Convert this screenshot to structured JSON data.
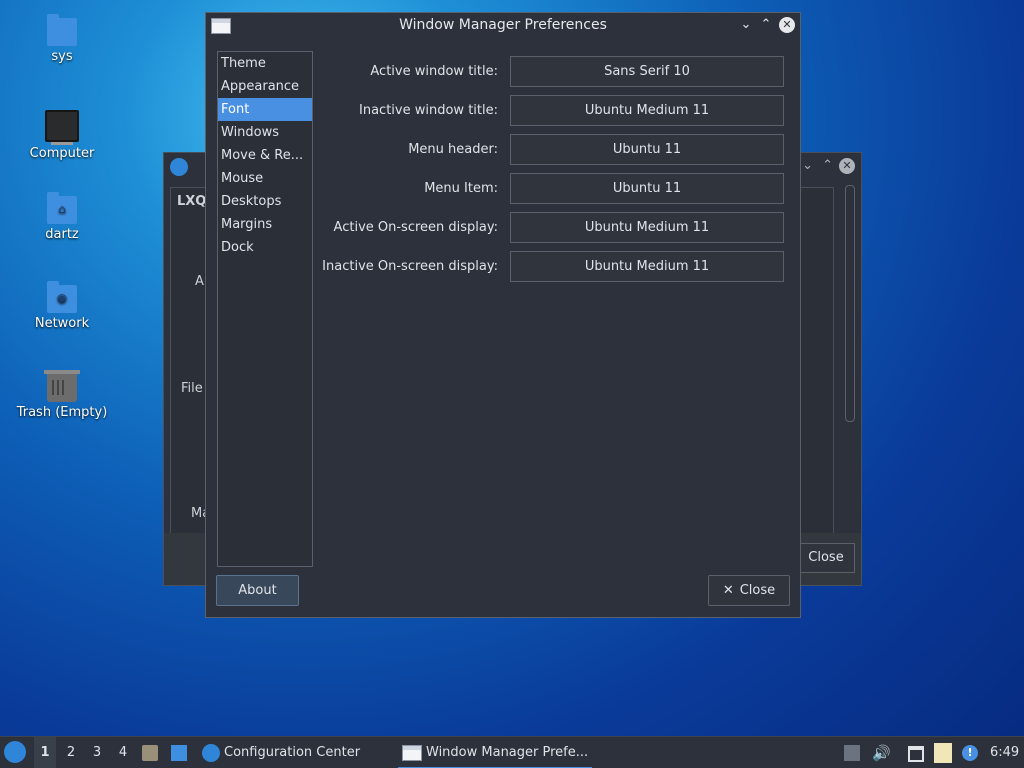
{
  "desktop": {
    "icons": [
      {
        "label": "sys",
        "icon": "folder-icon"
      },
      {
        "label": "Computer",
        "icon": "computer-icon"
      },
      {
        "label": "dartz",
        "icon": "home-folder-icon"
      },
      {
        "label": "Network",
        "icon": "network-folder-icon"
      },
      {
        "label": "Trash (Empty)",
        "icon": "trash-icon"
      }
    ]
  },
  "background_window": {
    "partial_texts": [
      "LXQ",
      "A",
      "File",
      "Ma"
    ],
    "close_label": "Close"
  },
  "window": {
    "title": "Window Manager Preferences",
    "sidebar": {
      "items": [
        "Theme",
        "Appearance",
        "Font",
        "Windows",
        "Move & Re...",
        "Mouse",
        "Desktops",
        "Margins",
        "Dock"
      ],
      "selected": "Font"
    },
    "fonts": [
      {
        "label": "Active window title:",
        "value": "Sans Serif 10"
      },
      {
        "label": "Inactive window title:",
        "value": "Ubuntu Medium 11"
      },
      {
        "label": "Menu header:",
        "value": "Ubuntu 11"
      },
      {
        "label": "Menu Item:",
        "value": "Ubuntu 11"
      },
      {
        "label": "Active On-screen display:",
        "value": "Ubuntu Medium 11"
      },
      {
        "label": "Inactive On-screen display:",
        "value": "Ubuntu Medium 11"
      }
    ],
    "about_label": "About",
    "close_label": "Close"
  },
  "taskbar": {
    "desktops": [
      "1",
      "2",
      "3",
      "4"
    ],
    "active_desktop": "1",
    "tasks": [
      {
        "label": "Configuration Center",
        "icon": "config-center-icon"
      },
      {
        "label": "Window Manager Prefe...",
        "icon": "window-icon"
      }
    ],
    "clock": "6:49"
  }
}
